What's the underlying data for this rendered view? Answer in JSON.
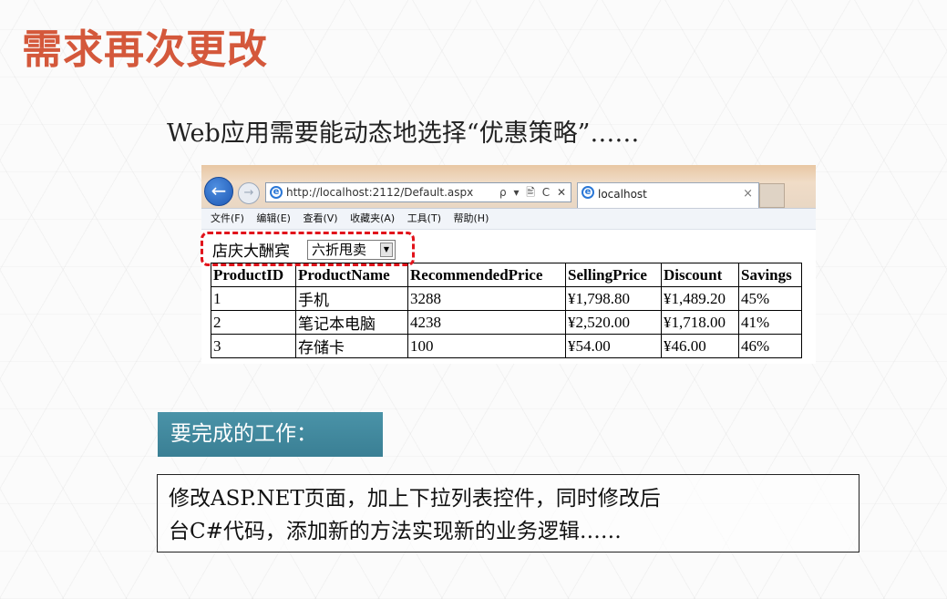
{
  "slide": {
    "title": "需求再次更改",
    "subtitle": "Web应用需要能动态地选择“优惠策略”……"
  },
  "browser": {
    "address": "http://localhost:2112/Default.aspx",
    "address_tools": "ρ ▾ 🖹 C ✕",
    "tab_title": "localhost",
    "tab_close": "×",
    "menu": [
      "文件(F)",
      "编辑(E)",
      "查看(V)",
      "收藏夹(A)",
      "工具(T)",
      "帮助(H)"
    ]
  },
  "page": {
    "promo_label": "店庆大酬宾",
    "promo_select_value": "六折甩卖",
    "table": {
      "headers": [
        "ProductID",
        "ProductName",
        "RecommendedPrice",
        "SellingPrice",
        "Discount",
        "Savings"
      ],
      "rows": [
        [
          "1",
          "手机",
          "3288",
          "¥1,798.80",
          "¥1,489.20",
          "45%"
        ],
        [
          "2",
          "笔记本电脑",
          "4238",
          "¥2,520.00",
          "¥1,718.00",
          "41%"
        ],
        [
          "3",
          "存储卡",
          "100",
          "¥54.00",
          "¥46.00",
          "46%"
        ]
      ]
    }
  },
  "work": {
    "label": "要完成的工作：",
    "description_line1": "修改ASP.NET页面，加上下拉列表控件，同时修改后",
    "description_line2": "台C#代码，添加新的方法实现新的业务逻辑……"
  },
  "colors": {
    "title": "#d4583b",
    "highlight": "#e1131b",
    "work_label_bg": "#4a93a8"
  }
}
